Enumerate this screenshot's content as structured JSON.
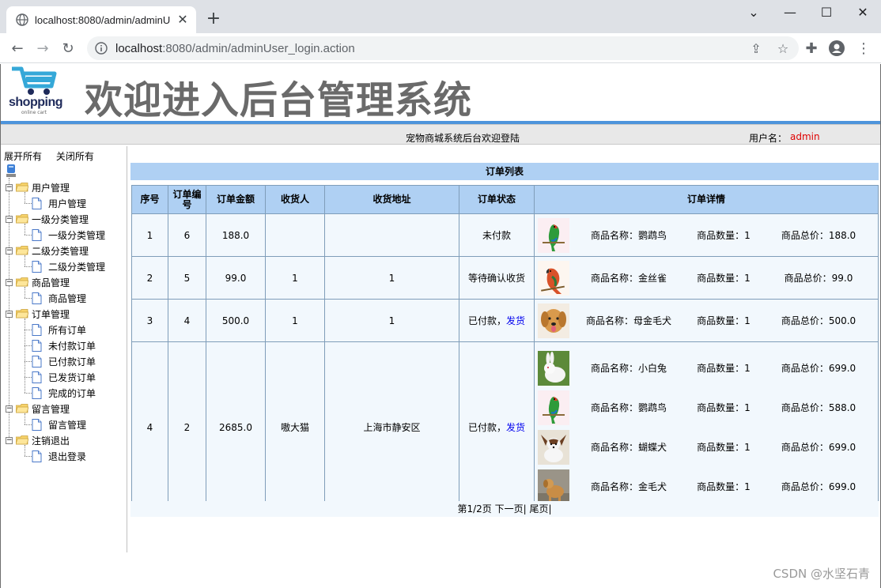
{
  "browser": {
    "tab_title": "localhost:8080/admin/adminU",
    "url_host": "localhost",
    "url_path": ":8080/admin/adminUser_login.action"
  },
  "header": {
    "logo_text": "shopping",
    "logo_sub": "online cart",
    "title": "欢迎进入后台管理系统",
    "welcome": "宠物商城系统后台欢迎登陆",
    "user_label": "用户名：",
    "user_name": "admin"
  },
  "tree": {
    "expand_all": "展开所有",
    "collapse_all": "关闭所有",
    "groups": [
      {
        "label": "用户管理",
        "items": [
          "用户管理"
        ]
      },
      {
        "label": "一级分类管理",
        "items": [
          "一级分类管理"
        ]
      },
      {
        "label": "二级分类管理",
        "items": [
          "二级分类管理"
        ]
      },
      {
        "label": "商品管理",
        "items": [
          "商品管理"
        ]
      },
      {
        "label": "订单管理",
        "items": [
          "所有订单",
          "未付款订单",
          "已付款订单",
          "已发货订单",
          "完成的订单"
        ]
      },
      {
        "label": "留言管理",
        "items": [
          "留言管理"
        ]
      },
      {
        "label": "注销退出",
        "items": [
          "退出登录"
        ]
      }
    ]
  },
  "orders": {
    "title": "订单列表",
    "columns": [
      "序号",
      "订单编号",
      "订单金额",
      "收货人",
      "收货地址",
      "订单状态",
      "订单详情"
    ],
    "rows": [
      {
        "seq": "1",
        "id": "6",
        "amount": "188.0",
        "receiver": "",
        "address": "",
        "status": "未付款",
        "action": "",
        "items": [
          {
            "name": "商品名称：鹦鹉鸟",
            "qty": "商品数量：1",
            "total": "商品总价：188.0",
            "pic": "parrot-green"
          }
        ]
      },
      {
        "seq": "2",
        "id": "5",
        "amount": "99.0",
        "receiver": "1",
        "address": "1",
        "status": "等待确认收货",
        "action": "",
        "items": [
          {
            "name": "商品名称：金丝雀",
            "qty": "商品数量：1",
            "total": "商品总价：99.0",
            "pic": "bird-red"
          }
        ]
      },
      {
        "seq": "3",
        "id": "4",
        "amount": "500.0",
        "receiver": "1",
        "address": "1",
        "status": "已付款，",
        "action": "发货",
        "items": [
          {
            "name": "商品名称：母金毛犬",
            "qty": "商品数量：1",
            "total": "商品总价：500.0",
            "pic": "golden-dog"
          }
        ]
      },
      {
        "seq": "4",
        "id": "2",
        "amount": "2685.0",
        "receiver": "嗷大猫",
        "address": "上海市静安区",
        "status": "已付款，",
        "action": "发货",
        "items": [
          {
            "name": "商品名称：小白兔",
            "qty": "商品数量：1",
            "total": "商品总价：699.0",
            "pic": "white-rabbit"
          },
          {
            "name": "商品名称：鹦鹉鸟",
            "qty": "商品数量：1",
            "total": "商品总价：588.0",
            "pic": "parrot-green"
          },
          {
            "name": "商品名称：蝴蝶犬",
            "qty": "商品数量：1",
            "total": "商品总价：699.0",
            "pic": "papillon-dog"
          },
          {
            "name": "商品名称：金毛犬",
            "qty": "商品数量：1",
            "total": "商品总价：699.0",
            "pic": "golden-dog-road"
          }
        ]
      }
    ],
    "pager": {
      "text": "第1/2页",
      "next": "下一页",
      "sep1": "|",
      "last": "尾页",
      "sep2": "|"
    }
  },
  "watermark": "CSDN @水坚石青"
}
